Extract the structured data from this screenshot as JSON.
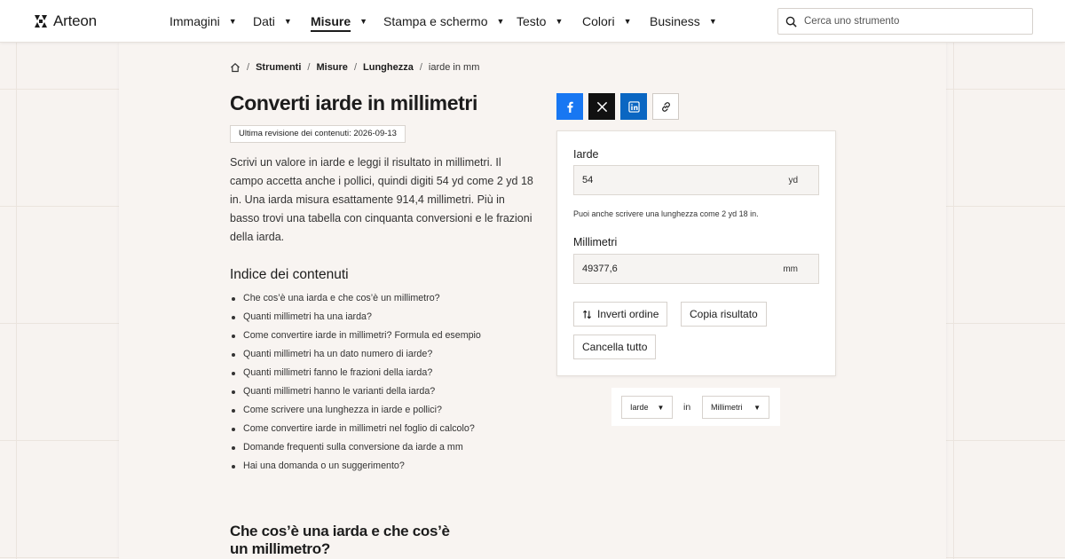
{
  "header": {
    "logo_text": "Arteon",
    "nav": [
      {
        "label": "Immagini",
        "active": false
      },
      {
        "label": "Dati",
        "active": false
      },
      {
        "label": "Misure",
        "active": true
      },
      {
        "label": "Stampa e schermo",
        "active": false
      },
      {
        "label": "Testo",
        "active": false
      },
      {
        "label": "Colori",
        "active": false
      },
      {
        "label": "Business",
        "active": false
      }
    ],
    "search_placeholder": "Cerca uno strumento"
  },
  "breadcrumb": {
    "items": [
      "Strumenti",
      "Misure",
      "Lunghezza"
    ],
    "current": "iarde in mm"
  },
  "page": {
    "title": "Converti iarde in millimetri",
    "revision": "Ultima revisione dei contenuti: 2026-09-13",
    "intro": "Scrivi un valore in iarde e leggi il risultato in millimetri. Il campo accetta anche i pollici, quindi digiti 54 yd come 2 yd 18 in. Una iarda misura esattamente 914,4 millimetri. Più in basso trovi una tabella con cinquanta conversioni e le frazioni della iarda.",
    "toc_title": "Indice dei contenuti",
    "toc": [
      "Che cos’è una iarda e che cos’è un millimetro?",
      "Quanti millimetri ha una iarda?",
      "Come convertire iarde in millimetri? Formula ed esempio",
      "Quanti millimetri ha un dato numero di iarde?",
      "Quanti millimetri fanno le frazioni della iarda?",
      "Quanti millimetri hanno le varianti della iarda?",
      "Come scrivere una lunghezza in iarde e pollici?",
      "Come convertire iarde in millimetri nel foglio di calcolo?",
      "Domande frequenti sulla conversione da iarde a mm",
      "Hai una domanda o un suggerimento?"
    ],
    "section_title": "Che cos’è una iarda e che cos’è un millimetro?"
  },
  "share": {
    "icons": [
      "facebook-icon",
      "x-icon",
      "linkedin-icon",
      "link-icon"
    ]
  },
  "converter": {
    "from_label": "Iarde",
    "from_value": "54",
    "from_unit": "yd",
    "hint": "Puoi anche scrivere una lunghezza come 2 yd 18 in.",
    "to_label": "Millimetri",
    "to_value": "49377,6",
    "to_unit": "mm",
    "swap_label": "Inverti ordine",
    "copy_label": "Copia risultato",
    "clear_label": "Cancella tutto"
  },
  "unit_selector": {
    "from": "Iarde",
    "in_label": "in",
    "to": "Millimetri"
  },
  "colors": {
    "facebook": "#1877f2",
    "x": "#111111",
    "linkedin": "#0a66c2",
    "background": "#f7f3f0"
  }
}
